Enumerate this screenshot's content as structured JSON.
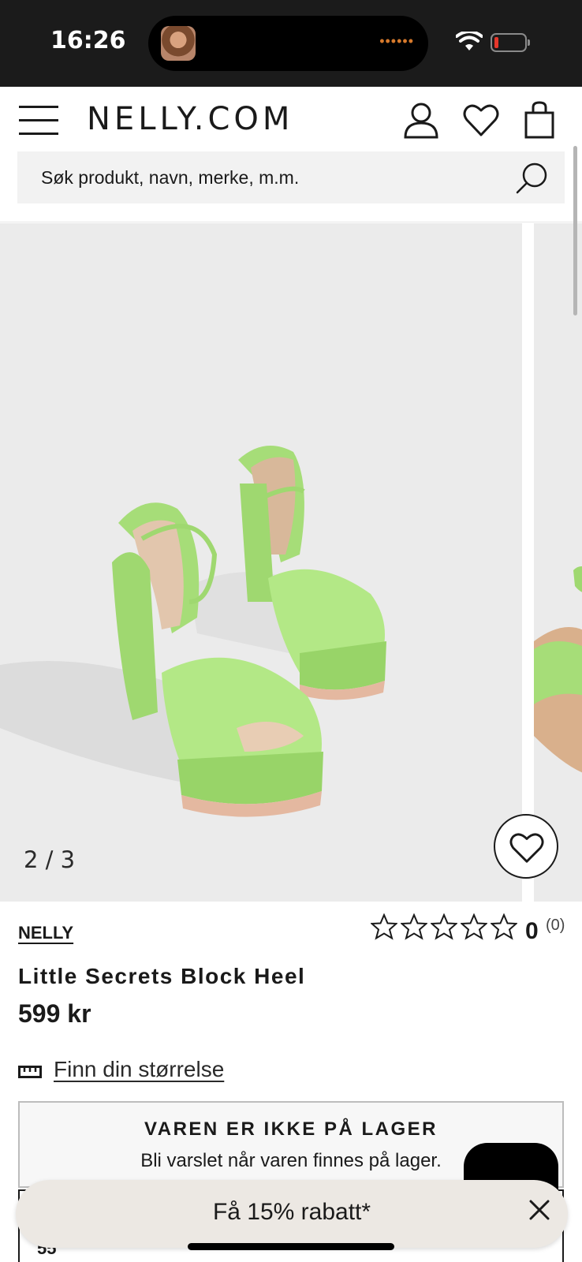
{
  "status_bar": {
    "time": "16:26",
    "island_dots": "••••••"
  },
  "header": {
    "logo": "NELLY.COM"
  },
  "search": {
    "placeholder": "Søk produkt, navn, merke, m.m."
  },
  "gallery": {
    "counter": "2 / 3"
  },
  "product": {
    "brand": "NELLY",
    "name": "Little Secrets Block Heel",
    "price": "599 kr",
    "rating_value": "0",
    "rating_count": "(0)",
    "rating_stars": 0,
    "rating_max": 5,
    "size_link": "Finn din størrelse"
  },
  "stock": {
    "title": "VAREN ER IKKE PÅ LAGER",
    "subtitle": "Bli varslet når varen finnes på lager."
  },
  "below": {
    "text": "55"
  },
  "promo": {
    "text": "Få 15% rabatt*"
  },
  "colors": {
    "accent": "#1a1a1a",
    "shoe": "#a8e07a",
    "battery_low": "#e5372b",
    "promo_bg": "#ece8e3"
  }
}
